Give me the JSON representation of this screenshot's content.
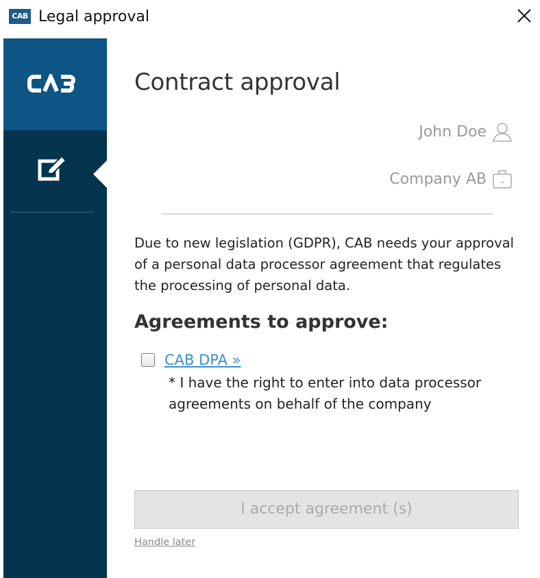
{
  "window": {
    "app_icon_text": "CAB",
    "title": "Legal approval",
    "close_icon": "close-icon"
  },
  "sidebar": {
    "logo_text": "CAB",
    "items": [
      {
        "name": "edit",
        "icon": "edit-icon",
        "active": true
      }
    ]
  },
  "main": {
    "title": "Contract approval",
    "user_name": "John Doe",
    "user_icon": "user-icon",
    "company_name": "Company AB",
    "company_icon": "briefcase-icon",
    "intro": "Due to new legislation (GDPR), CAB needs your approval of a personal data processor agreement that regulates the processing of personal data.",
    "agreements_heading": "Agreements to approve:",
    "agreements": [
      {
        "label": "CAB DPA »",
        "checked": false,
        "note": "* I have the right to enter into data processor agreements on behalf of the company"
      }
    ],
    "accept_button_label": "I accept agreement (s)",
    "handle_later_label": "Handle later"
  },
  "colors": {
    "sidebar_bg": "#05344e",
    "logo_bg": "#0c5584",
    "link": "#3a8fd0",
    "button_disabled_bg": "#e4e4e4",
    "button_disabled_text": "#aaaaaa"
  }
}
